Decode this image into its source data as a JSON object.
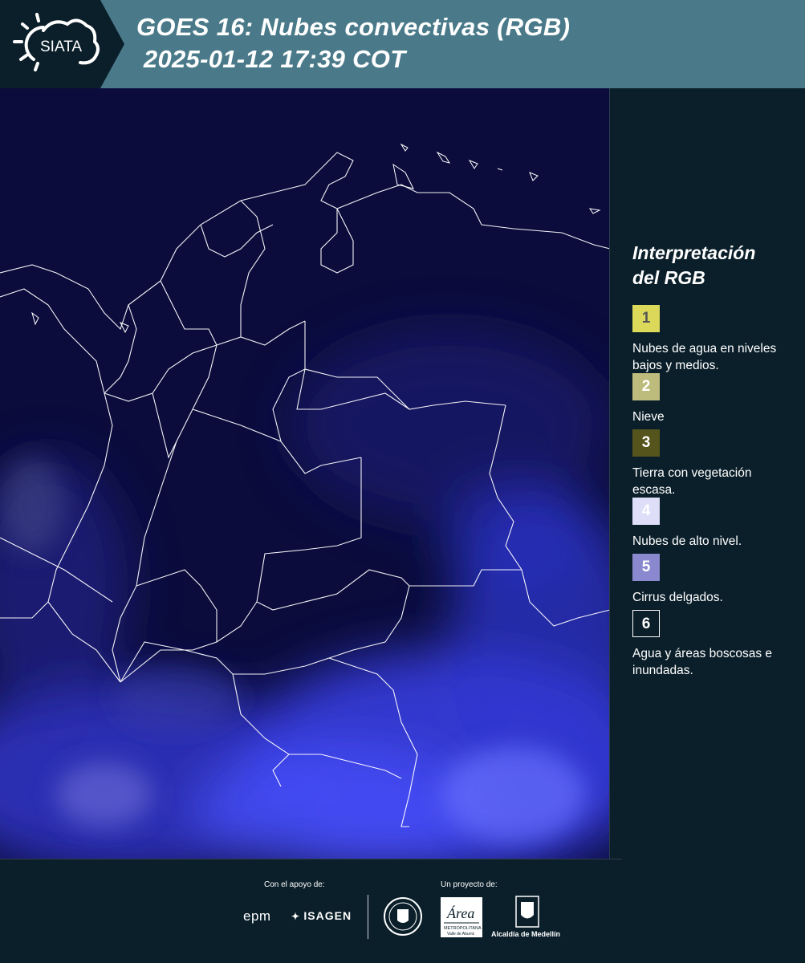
{
  "header": {
    "logo_text": "SIATA",
    "title_line1": "GOES 16: Nubes convectivas (RGB)",
    "title_line2": " 2025-01-12 17:39 COT"
  },
  "legend": {
    "title_line1": "Interpretación",
    "title_line2": "del RGB",
    "items": [
      {
        "number": "1",
        "color": "#dcd95a",
        "text_color": "#555555",
        "label": "Nubes de agua en niveles bajos y medios."
      },
      {
        "number": "2",
        "color": "#bebc7c",
        "text_color": "#ffffff",
        "label": "Nieve"
      },
      {
        "number": "3",
        "color": "#55541c",
        "text_color": "#ffffff",
        "label": "Tierra con vegetación escasa."
      },
      {
        "number": "4",
        "color": "#dedef8",
        "text_color": "#ffffff",
        "label": "Nubes de alto nivel."
      },
      {
        "number": "5",
        "color": "#8a89cf",
        "text_color": "#ffffff",
        "label": "Cirrus delgados."
      },
      {
        "number": "6",
        "color": "#0b1f2a",
        "text_color": "#ffffff",
        "label": "Agua y áreas boscosas e inundadas."
      }
    ]
  },
  "footer": {
    "support_label": "Con el apoyo de:",
    "project_label": "Un proyecto de:",
    "sponsor_epm": "epm",
    "sponsor_isagen": "ISAGEN",
    "project_area": "Área Metropolitana Valle de Aburrá",
    "project_alcaldia": "Alcaldía de Medellín"
  },
  "colors": {
    "header_bg": "#4a7a8a",
    "page_bg": "#0b1f2a",
    "map_bg": "#0b0c3c",
    "cloud_blue": "#3a43ff",
    "border_line": "#ffffff"
  },
  "icons": [
    "siata-sun-cloud-logo",
    "epm-logo",
    "isagen-logo",
    "medellin-seal",
    "area-metropolitana-logo",
    "alcaldia-shield-logo"
  ]
}
